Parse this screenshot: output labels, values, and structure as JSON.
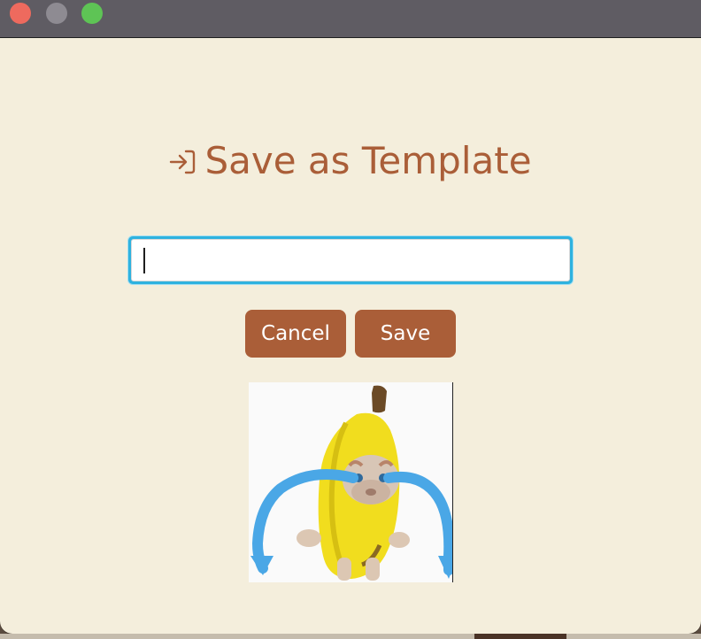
{
  "window": {
    "controls": [
      "close",
      "minimize",
      "zoom"
    ]
  },
  "dialog": {
    "title_icon": "login-arrow-icon",
    "title": "Save as Template",
    "input": {
      "value": "",
      "placeholder": ""
    },
    "cancel_label": "Cancel",
    "save_label": "Save"
  },
  "colors": {
    "accent": "#aa5e38",
    "background": "#f4eedc",
    "focus_ring": "#2eb2df",
    "close": "#ee6a5e",
    "minimize": "#8e8b92",
    "zoom": "#5ec455"
  },
  "sticker": {
    "icon": "crying-banana-cat-sticker"
  }
}
